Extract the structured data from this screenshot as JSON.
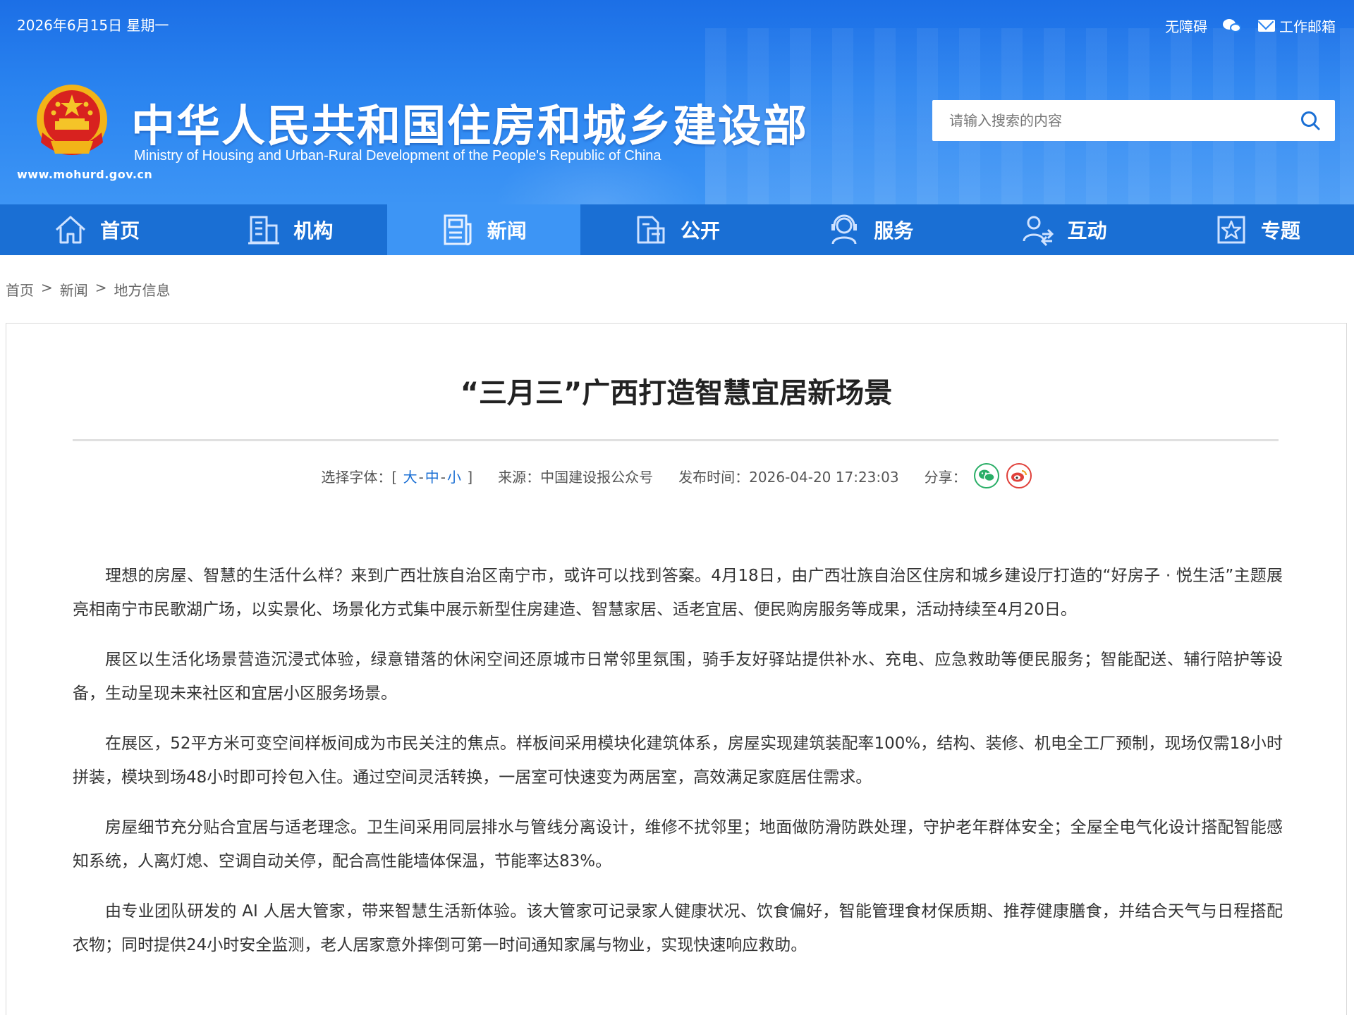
{
  "header": {
    "date": "2026年6月15日 星期一",
    "links": {
      "accessibility": "无障碍",
      "mail": "工作邮箱"
    },
    "title_cn": "中华人民共和国住房和城乡建设部",
    "title_en": "Ministry of Housing and Urban-Rural Development of the People's Republic of China",
    "site_url": "www.mohurd.gov.cn",
    "search_placeholder": "请输入搜索的内容",
    "colors": {
      "primary": "#1a6fd4",
      "active": "#3d95f5"
    }
  },
  "nav": {
    "items": [
      {
        "label": "首页",
        "icon": "home-icon"
      },
      {
        "label": "机构",
        "icon": "building-icon"
      },
      {
        "label": "新闻",
        "icon": "news-icon"
      },
      {
        "label": "公开",
        "icon": "document-icon"
      },
      {
        "label": "服务",
        "icon": "service-icon"
      },
      {
        "label": "互动",
        "icon": "interaction-icon"
      },
      {
        "label": "专题",
        "icon": "star-icon"
      }
    ],
    "active_index": 2
  },
  "breadcrumb": [
    "首页",
    "新闻",
    "地方信息"
  ],
  "article": {
    "title": "“三月三”广西打造智慧宜居新场景",
    "font_label": "选择字体：[",
    "font_large": "大",
    "font_medium": "中",
    "font_small": "小",
    "font_close": "]",
    "source": "来源：中国建设报公众号",
    "published": "发布时间：2026-04-20 17:23:03",
    "share_label": "分享：",
    "paragraphs": [
      "理想的房屋、智慧的生活什么样？来到广西壮族自治区南宁市，或许可以找到答案。4月18日，由广西壮族自治区住房和城乡建设厅打造的“好房子 · 悦生活”主题展亮相南宁市民歌湖广场，以实景化、场景化方式集中展示新型住房建造、智慧家居、适老宜居、便民购房服务等成果，活动持续至4月20日。",
      "展区以生活化场景营造沉浸式体验，绿意错落的休闲空间还原城市日常邻里氛围，骑手友好驿站提供补水、充电、应急救助等便民服务；智能配送、辅行陪护等设备，生动呈现未来社区和宜居小区服务场景。",
      "在展区，52平方米可变空间样板间成为市民关注的焦点。样板间采用模块化建筑体系，房屋实现建筑装配率100%，结构、装修、机电全工厂预制，现场仅需18小时拼装，模块到场48小时即可拎包入住。通过空间灵活转换，一居室可快速变为两居室，高效满足家庭居住需求。",
      "房屋细节充分贴合宜居与适老理念。卫生间采用同层排水与管线分离设计，维修不扰邻里；地面做防滑防跌处理，守护老年群体安全；全屋全电气化设计搭配智能感知系统，人离灯熄、空调自动关停，配合高性能墙体保温，节能率达83%。",
      "由专业团队研发的 AI 人居大管家，带来智慧生活新体验。该大管家可记录家人健康状况、饮食偏好，智能管理食材保质期、推荐健康膳食，并结合天气与日程搭配衣物；同时提供24小时安全监测，老人居家意外摔倒可第一时间通知家属与物业，实现快速响应救助。"
    ]
  }
}
